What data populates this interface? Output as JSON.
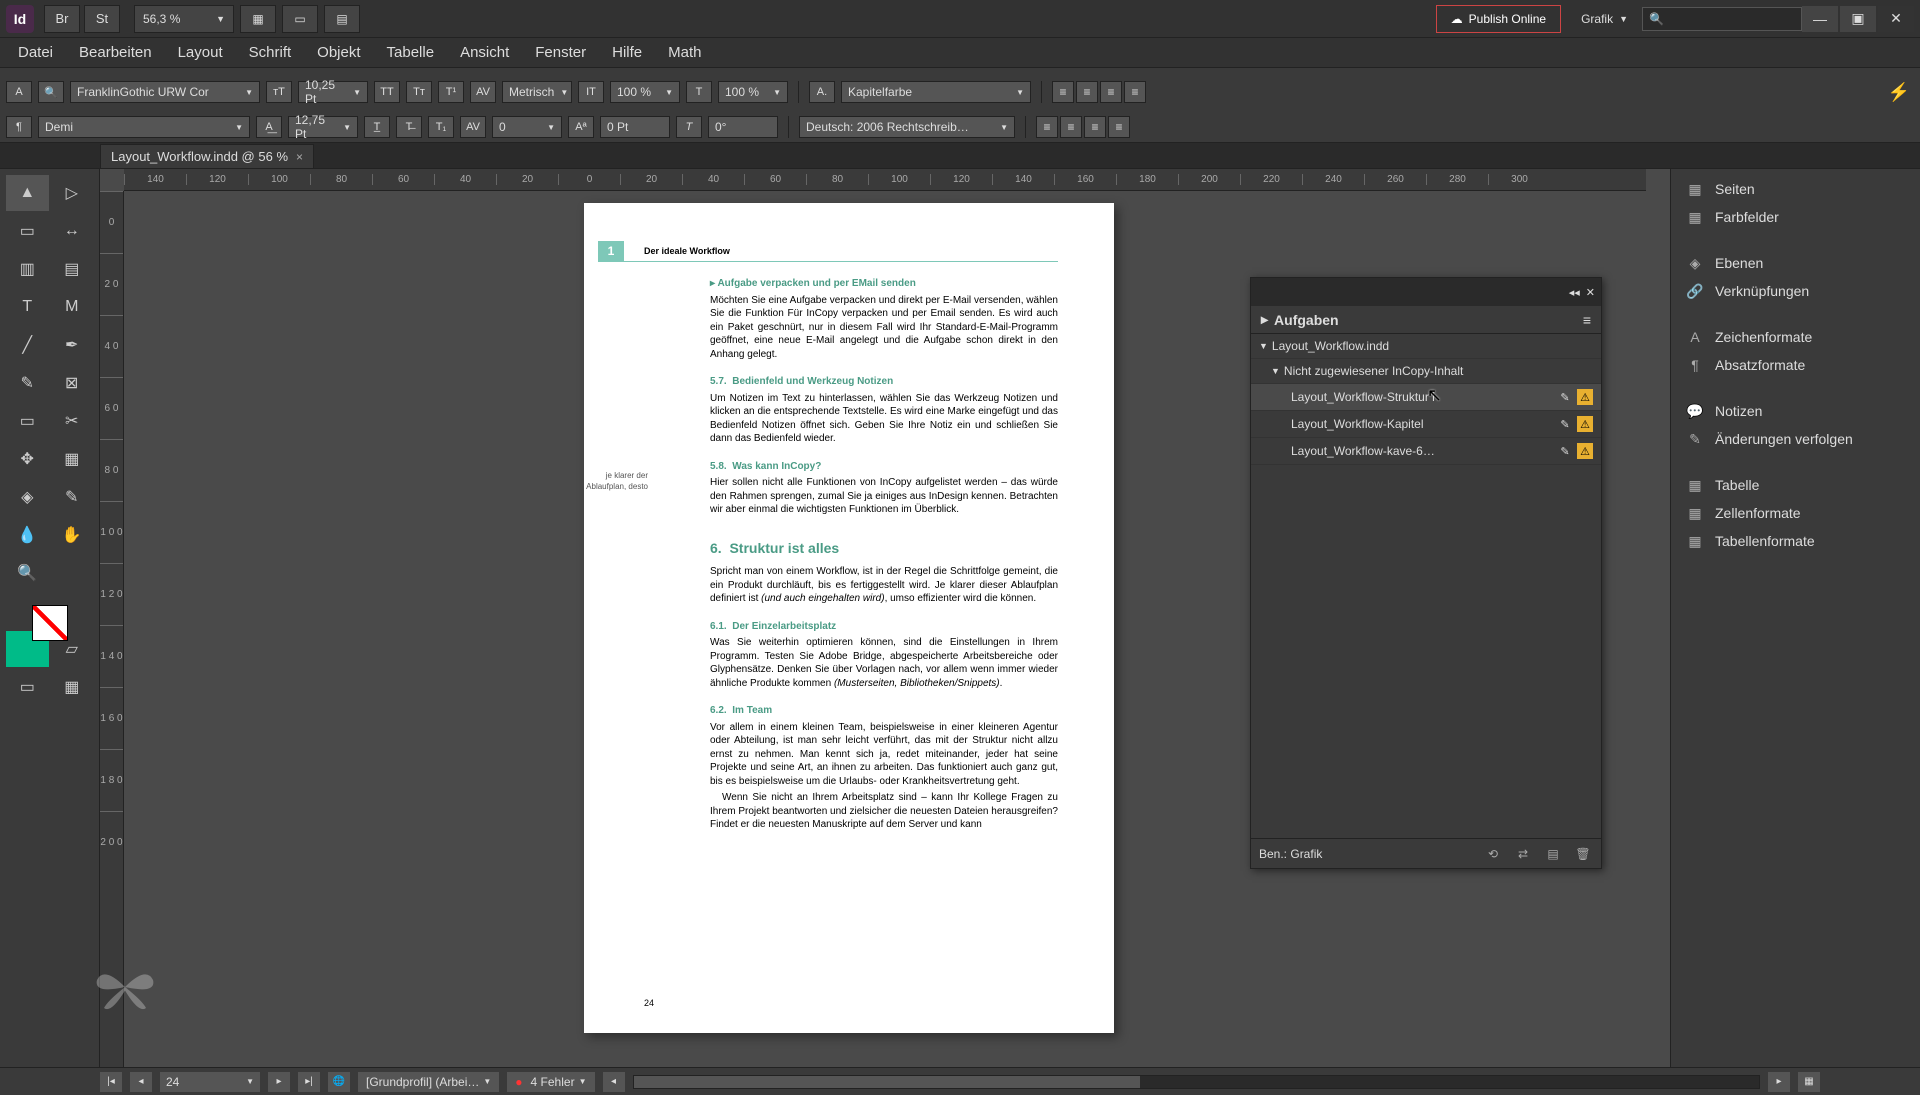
{
  "app": {
    "id_short": "Id",
    "br": "Br",
    "st": "St",
    "zoom": "56,3 %"
  },
  "topbar": {
    "publish": "Publish Online",
    "workspace": "Grafik"
  },
  "win": {
    "min": "—",
    "max": "▣",
    "close": "✕"
  },
  "menu": [
    "Datei",
    "Bearbeiten",
    "Layout",
    "Schrift",
    "Objekt",
    "Tabelle",
    "Ansicht",
    "Fenster",
    "Hilfe",
    "Math"
  ],
  "ctrl": {
    "font": "FranklinGothic URW Cor",
    "style": "Demi",
    "size": "10,25 Pt",
    "leading": "12,75 Pt",
    "metrics": "Metrisch",
    "kerning": "0",
    "hscale": "100 %",
    "vscale": "100 %",
    "baseline": "0 Pt",
    "skew": "0°",
    "cstyle": "Kapitelfarbe",
    "lang": "Deutsch: 2006 Rechtschreib…"
  },
  "doctab": {
    "name": "Layout_Workflow.indd @ 56 %"
  },
  "ruler_h": [
    "140",
    "120",
    "100",
    "80",
    "60",
    "40",
    "20",
    "0",
    "20",
    "40",
    "60",
    "80",
    "100",
    "120",
    "140",
    "160",
    "180",
    "200",
    "220",
    "240",
    "260",
    "280",
    "300"
  ],
  "ruler_v": [
    "0",
    "2 0",
    "4 0",
    "6 0",
    "8 0",
    "1 0 0",
    "1 2 0",
    "1 4 0",
    "1 6 0",
    "1 8 0",
    "2 0 0"
  ],
  "page": {
    "running": "Der ideale Workflow",
    "chapter": "1",
    "s1_title": "Aufgabe verpacken und per EMail senden",
    "s1_body": "Möchten Sie eine Aufgabe verpacken und direkt per E-Mail versenden, wählen Sie die Funktion Für InCopy verpacken und per Email senden. Es wird auch ein Paket geschnürt, nur in diesem Fall wird Ihr Standard-E-Mail-Programm geöffnet, eine neue E-Mail angelegt und die Aufgabe schon direkt in den Anhang gelegt.",
    "s2_num": "5.7.",
    "s2_title": "Bedienfeld und Werkzeug Notizen",
    "s2_body": "Um Notizen im Text zu hinterlassen, wählen Sie das Werkzeug Notizen und klicken an die entsprechende Textstelle. Es wird eine Marke eingefügt und das Bedienfeld Notizen öffnet sich. Geben Sie Ihre Notiz ein und schließen Sie dann das Bedienfeld wieder.",
    "s3_num": "5.8.",
    "s3_title": "Was kann InCopy?",
    "s3_body": "Hier sollen nicht alle Funktionen von InCopy aufgelistet werden – das würde den Rahmen sprengen, zumal Sie ja einiges aus InDesign kennen. Betrachten wir aber einmal die wichtigsten Funktionen im Überblick.",
    "margin_note": "je klarer der Ablaufplan, desto",
    "s4_num": "6.",
    "s4_title": "Struktur ist alles",
    "s4_body_a": "Spricht man von einem Workflow, ist in der Regel die Schrittfolge gemeint, die ein Produkt durchläuft, bis es fertiggestellt wird. Je klarer dieser Ablaufplan definiert ist ",
    "s4_body_i": "(und auch eingehalten wird)",
    "s4_body_b": ", umso effizienter wird die können.",
    "s5_num": "6.1.",
    "s5_title": "Der Einzelarbeitsplatz",
    "s5_body_a": "Was Sie weiterhin optimieren können, sind die Einstellungen in Ihrem Programm. Testen Sie Adobe Bridge, abgespeicherte Arbeitsbereiche oder Glyphensätze. Denken Sie über Vorlagen nach, vor allem wenn immer wieder ähnliche Produkte kommen ",
    "s5_body_i": "(Musterseiten, Bibliotheken/Snippets)",
    "s5_body_b": ".",
    "s6_num": "6.2.",
    "s6_title": "Im Team",
    "s6_body": "Vor allem in einem kleinen Team, beispielsweise in einer kleineren Agentur oder Abteilung, ist man sehr leicht verführt, das mit der Struktur nicht allzu ernst zu nehmen. Man kennt sich ja, redet miteinander, jeder hat seine Projekte und seine Art, an ihnen zu arbeiten. Das funktioniert auch ganz gut, bis es beispielsweise um die Urlaubs- oder Krankheitsvertretung geht.",
    "s6_body2": "Wenn Sie nicht an Ihrem Arbeitsplatz sind – kann Ihr Kollege Fragen zu Ihrem Projekt beantworten und zielsicher die neuesten Dateien herausgreifen? Findet er die neuesten Manuskripte auf dem Server und kann",
    "pagenum": "24"
  },
  "aufgaben": {
    "title": "Aufgaben",
    "root": "Layout_Workflow.indd",
    "group": "Nicht zugewiesener InCopy-Inhalt",
    "items": [
      "Layout_Workflow-Struktur i",
      "Layout_Workflow-Kapitel",
      "Layout_Workflow-kave-6…"
    ],
    "user": "Ben.: Grafik"
  },
  "dock": {
    "g1": [
      "Seiten",
      "Farbfelder"
    ],
    "g2": [
      "Ebenen",
      "Verknüpfungen"
    ],
    "g3": [
      "Zeichenformate",
      "Absatzformate"
    ],
    "g4": [
      "Notizen",
      "Änderungen verfolgen"
    ],
    "g5": [
      "Tabelle",
      "Zellenformate",
      "Tabellenformate"
    ]
  },
  "status": {
    "page": "24",
    "profile": "[Grundprofil] (Arbei…",
    "errors": "4 Fehler"
  }
}
